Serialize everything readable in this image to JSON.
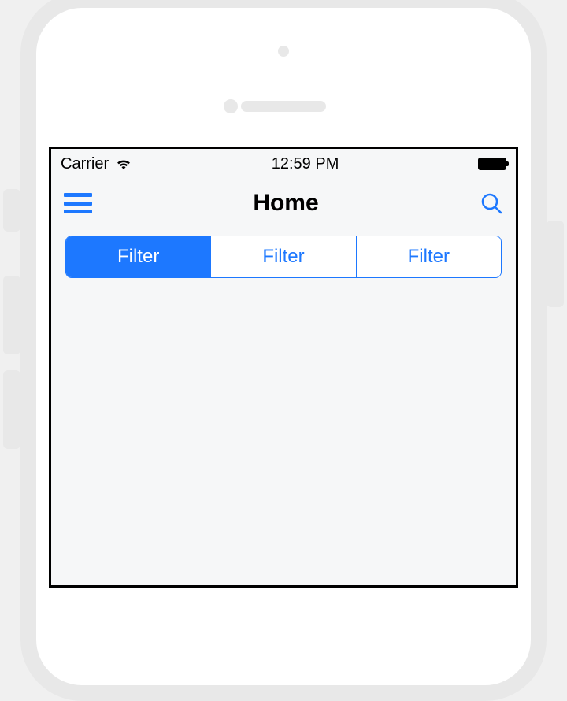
{
  "status_bar": {
    "carrier": "Carrier",
    "time": "12:59 PM"
  },
  "nav": {
    "title": "Home"
  },
  "segments": [
    {
      "label": "Filter",
      "active": true
    },
    {
      "label": "Filter",
      "active": false
    },
    {
      "label": "Filter",
      "active": false
    }
  ],
  "colors": {
    "accent": "#1D78FF"
  }
}
